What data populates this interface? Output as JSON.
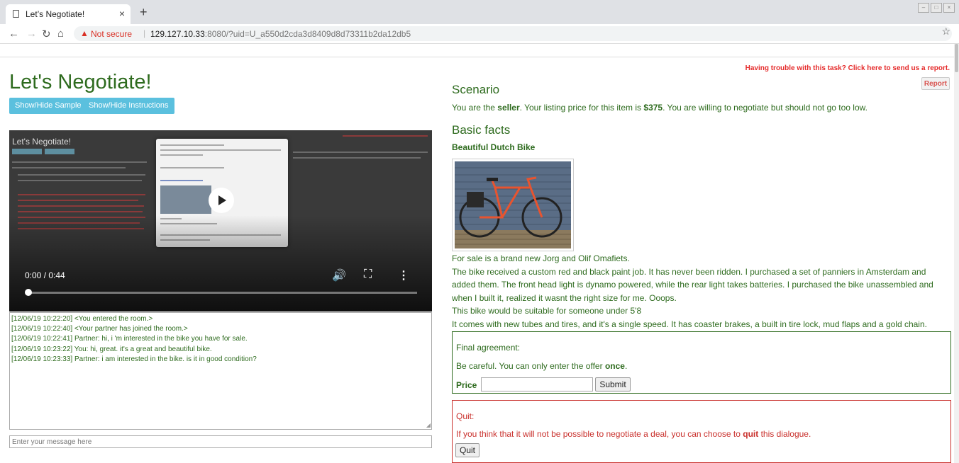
{
  "browser": {
    "tab_title": "Let’s Negotiate!",
    "tab_close": "×",
    "new_tab": "+",
    "not_secure": "Not secure",
    "url_host": "129.127.10.33",
    "url_rest": ":8080/?uid=U_a550d2cda3d8409d8d73311b2da12db5"
  },
  "left": {
    "title": "Let's Negotiate!",
    "show_sample_label": "Show/Hide Sample",
    "show_instructions_label": "Show/Hide Instructions",
    "video": {
      "time": "0:00 / 0:44",
      "progress": 0.0,
      "thumb_title": "Let's Negotiate!"
    },
    "chat_messages": [
      "[12/06/19 10:22:20] <You entered the room.>",
      "[12/06/19 10:22:40] <Your partner has joined the room.>",
      "[12/06/19 10:22:41] Partner: hi, i 'm interested in the bike you have for sale.",
      "[12/06/19 10:23:22] You: hi, great. it's a great and beautiful bike.",
      "[12/06/19 10:23:33] Partner: i am interested in the bike. is it in good condition?"
    ],
    "message_placeholder": "Enter your message here"
  },
  "right": {
    "trouble_link": "Having trouble with this task? Click here to send us a report.",
    "report_label": "Report",
    "scenario_heading": "Scenario",
    "scenario_pre": "You are the ",
    "scenario_role": "seller",
    "scenario_mid": ". Your listing price for this item is ",
    "scenario_price": "$375",
    "scenario_post": ". You are willing to negotiate but should not go too low.",
    "facts_heading": "Basic facts",
    "item_title": "Beautiful Dutch Bike",
    "description": [
      "For sale is a brand new Jorg and Olif Omafiets.",
      "The bike received a custom red and black paint job. It has never been ridden. I purchased a set of panniers in Amsterdam and added them. The front head light is dynamo powered, while the rear light takes batteries. I purchased the bike unassembled and when I built it, realized it wasnt the right size for me. Ooops.",
      "This bike would be suitable for someone under 5'8",
      "It comes with new tubes and tires, and it's a single speed. It has coaster brakes, a built in tire lock, mud flaps and a gold chain."
    ],
    "agreement": {
      "label": "Final agreement:",
      "warning_pre": "Be careful. You can only enter the offer ",
      "warning_bold": "once",
      "warning_post": ".",
      "price_label": "Price",
      "price_value": "",
      "submit_label": "Submit"
    },
    "quit": {
      "label": "Quit:",
      "text_pre": "If you think that it will not be possible to negotiate a deal, you can choose to ",
      "text_bold": "quit",
      "text_post": " this dialogue.",
      "button_label": "Quit"
    }
  },
  "colors": {
    "green": "#2e6b1e",
    "red": "#c9302c",
    "blue_button": "#5bc0de"
  }
}
